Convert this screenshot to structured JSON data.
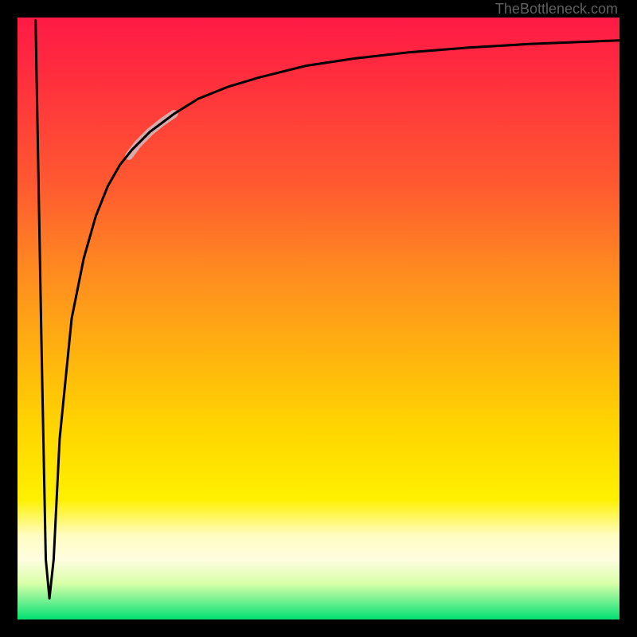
{
  "attribution": "TheBottleneck.com",
  "chart_data": {
    "type": "line",
    "title": "",
    "xlabel": "",
    "ylabel": "",
    "xlim": [
      0,
      100
    ],
    "ylim": [
      0,
      100
    ],
    "grid": false,
    "series": [
      {
        "name": "bottleneck-curve",
        "stroke": "#000000",
        "strokeWidth": 3,
        "x": [
          3.0,
          4.0,
          4.7,
          5.3,
          6.0,
          7.0,
          9.0,
          11.0,
          13.0,
          15.0,
          17.0,
          19.0,
          22.0,
          26.0,
          30.0,
          35.0,
          40.0,
          48.0,
          56.0,
          65.0,
          75.0,
          85.0,
          95.0,
          100.0
        ],
        "y": [
          99.5,
          45.0,
          10.0,
          3.5,
          10.0,
          30.0,
          50.0,
          60.0,
          67.0,
          72.0,
          75.5,
          78.0,
          81.0,
          84.0,
          86.5,
          88.5,
          90.0,
          92.0,
          93.2,
          94.2,
          95.0,
          95.6,
          96.0,
          96.2
        ]
      },
      {
        "name": "highlight-segment",
        "stroke": "#d8aaaa",
        "strokeWidth": 10,
        "x": [
          18.5,
          20.0,
          22.0,
          24.0,
          26.0
        ],
        "y": [
          77.0,
          79.0,
          81.0,
          82.6,
          84.0
        ]
      }
    ],
    "background_gradient_stops": [
      {
        "pos": 0.0,
        "color": "#ff1a45"
      },
      {
        "pos": 0.28,
        "color": "#ff5a30"
      },
      {
        "pos": 0.55,
        "color": "#ffb010"
      },
      {
        "pos": 0.8,
        "color": "#fff000"
      },
      {
        "pos": 0.9,
        "color": "#fffde0"
      },
      {
        "pos": 1.0,
        "color": "#00e070"
      }
    ]
  }
}
